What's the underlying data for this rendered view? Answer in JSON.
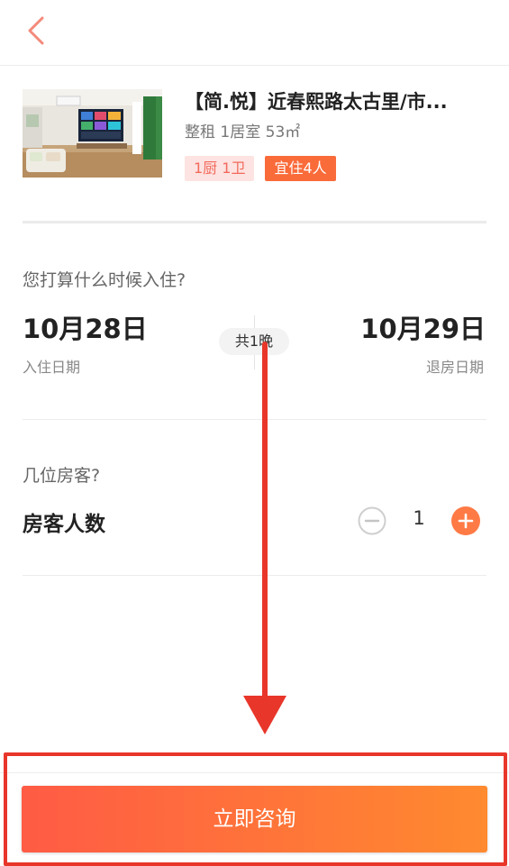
{
  "header": {
    "back_icon": "chevron-left-icon",
    "accent_color": "#f4897a"
  },
  "listing": {
    "title": "【简.悦】近春熙路太古里/市...",
    "subtitle": "整租 1居室 53㎡",
    "tags": [
      "1厨 1卫",
      "宜住4人"
    ]
  },
  "stay": {
    "question": "您打算什么时候入住?",
    "checkin_date": "10月28日",
    "checkin_label": "入住日期",
    "checkout_date": "10月29日",
    "checkout_label": "退房日期",
    "nights": "共1晚"
  },
  "guests": {
    "question": "几位房客?",
    "label": "房客人数",
    "count": "1",
    "minus_icon": "minus-circle-icon",
    "plus_icon": "plus-circle-icon",
    "plus_color": "#ff7a45"
  },
  "cta": {
    "label": "立即咨询",
    "gradient_start": "#ff5b45",
    "gradient_end": "#ff8a2f"
  },
  "annotation": {
    "color": "#e8362a"
  }
}
